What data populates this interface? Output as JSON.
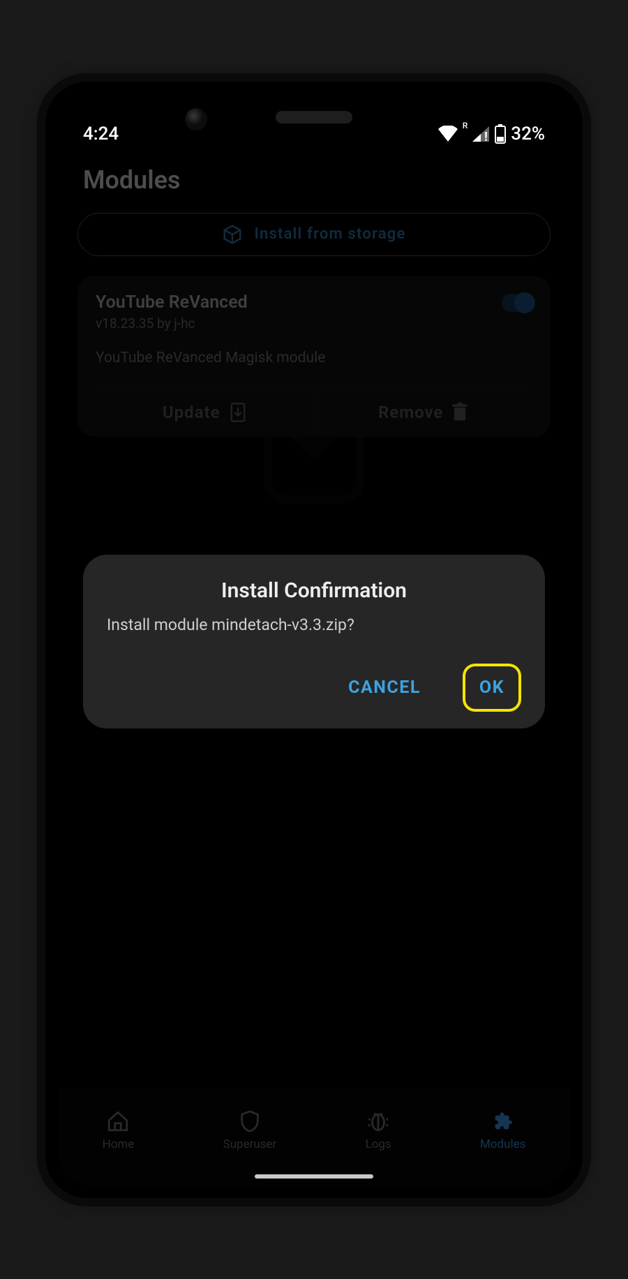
{
  "status": {
    "time": "4:24",
    "roaming": "R",
    "battery": "32%"
  },
  "header": {
    "title": "Modules"
  },
  "install_from_storage": {
    "label": "Install from storage"
  },
  "module": {
    "title": "YouTube ReVanced",
    "subtitle": "v18.23.35 by j-hc",
    "description": "YouTube ReVanced Magisk module",
    "update_label": "Update",
    "remove_label": "Remove"
  },
  "dialog": {
    "title": "Install Confirmation",
    "message": "Install module mindetach-v3.3.zip?",
    "cancel": "CANCEL",
    "ok": "OK"
  },
  "nav": {
    "home": "Home",
    "superuser": "Superuser",
    "logs": "Logs",
    "modules": "Modules"
  }
}
